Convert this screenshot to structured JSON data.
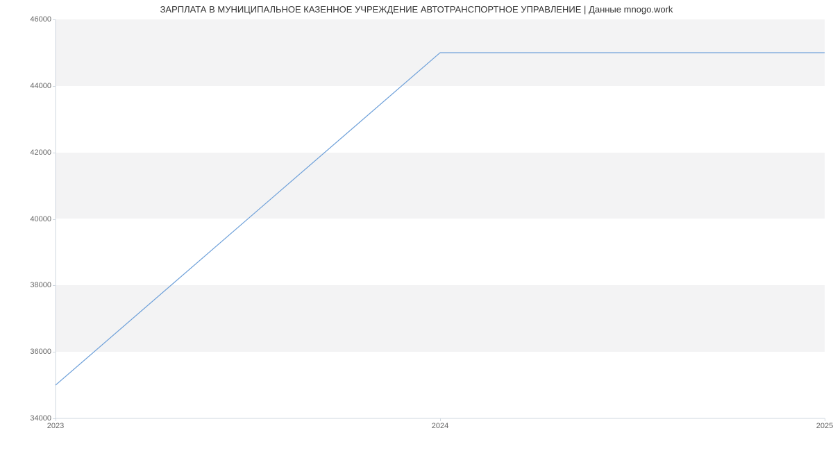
{
  "chart_data": {
    "type": "line",
    "title": "ЗАРПЛАТА В МУНИЦИПАЛЬНОЕ КАЗЕННОЕ УЧРЕЖДЕНИЕ АВТОТРАНСПОРТНОЕ УПРАВЛЕНИЕ | Данные mnogo.work",
    "x": [
      2023,
      2024,
      2025
    ],
    "values": [
      35000,
      45000,
      45000
    ],
    "x_ticks": [
      "2023",
      "2024",
      "2025"
    ],
    "y_ticks": [
      "34000",
      "36000",
      "38000",
      "40000",
      "42000",
      "44000",
      "46000"
    ],
    "xlim": [
      2023,
      2025
    ],
    "ylim": [
      34000,
      46000
    ]
  }
}
